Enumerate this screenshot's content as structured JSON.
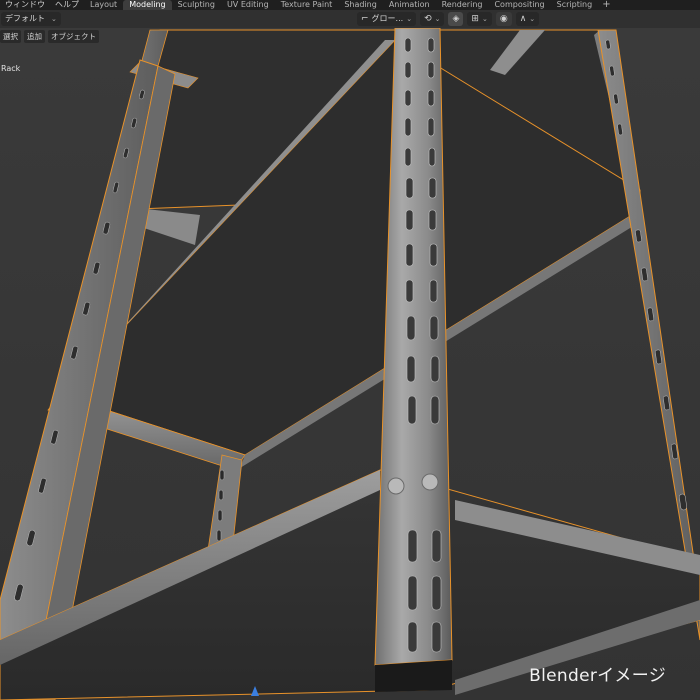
{
  "menu": {
    "items": [
      "ウィンドウ",
      "ヘルプ"
    ]
  },
  "workspaces": {
    "tabs": [
      "Layout",
      "Modeling",
      "Sculpting",
      "UV Editing",
      "Texture Paint",
      "Shading",
      "Animation",
      "Rendering",
      "Compositing",
      "Scripting"
    ],
    "active": "Modeling",
    "add_label": "+"
  },
  "header": {
    "mode": "デフォルト",
    "transform_orientation": "グロー..."
  },
  "subheader": {
    "buttons": [
      "選択",
      "追加",
      "オブジェクト"
    ]
  },
  "viewport": {
    "object_name": "Rack",
    "caption": "Blenderイメージ",
    "selection_color": "#e8922a"
  }
}
